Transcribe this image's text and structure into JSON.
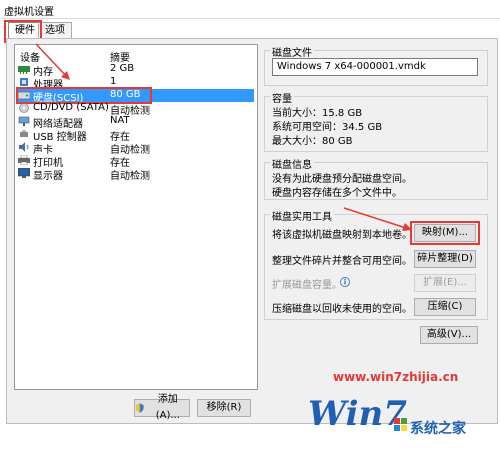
{
  "window": {
    "title": "虚拟机设置"
  },
  "tabs": [
    {
      "label": "硬件",
      "active": true
    },
    {
      "label": "选项",
      "active": false
    }
  ],
  "device_table": {
    "col_device": "设备",
    "col_summary": "摘要",
    "rows": [
      {
        "name": "内存",
        "summary": "2 GB",
        "icon": "memory-icon"
      },
      {
        "name": "处理器",
        "summary": "1",
        "icon": "processor-icon"
      },
      {
        "name": "硬盘(SCSI)",
        "summary": "80 GB",
        "icon": "hard-disk-icon",
        "selected": true
      },
      {
        "name": "CD/DVD (SATA)",
        "summary": "自动检测",
        "icon": "cd-dvd-icon"
      },
      {
        "name": "网络适配器",
        "summary": "NAT",
        "icon": "network-adapter-icon"
      },
      {
        "name": "USB 控制器",
        "summary": "存在",
        "icon": "usb-icon"
      },
      {
        "name": "声卡",
        "summary": "自动检测",
        "icon": "sound-card-icon"
      },
      {
        "name": "打印机",
        "summary": "存在",
        "icon": "printer-icon"
      },
      {
        "name": "显示器",
        "summary": "自动检测",
        "icon": "display-icon"
      }
    ]
  },
  "buttons": {
    "add": "添加(A)...",
    "remove": "移除(R)"
  },
  "disk_file": {
    "label": "磁盘文件",
    "value": "Windows 7 x64-000001.vmdk"
  },
  "capacity": {
    "label": "容量",
    "current": "当前大小：15.8 GB",
    "free": "系统可用空间：34.5 GB",
    "max": "最大大小：80 GB"
  },
  "disk_info": {
    "label": "磁盘信息",
    "line1": "没有为此硬盘预分配磁盘空间。",
    "line2": "硬盘内容存储在多个文件中。"
  },
  "utilities": {
    "label": "磁盘实用工具",
    "map_desc": "将该虚拟机磁盘映射到本地卷。",
    "map_btn": "映射(M)...",
    "defrag_desc": "整理文件碎片并整合可用空间。",
    "defrag_btn": "碎片整理(D)",
    "expand_desc": "扩展磁盘容量。",
    "expand_btn": "扩展(E)...",
    "compact_desc": "压缩磁盘以回收未使用的空间。",
    "compact_btn": "压缩(C)"
  },
  "advanced_btn": "高级(V)...",
  "watermark": {
    "url": "www.win7zhijia.cn",
    "logo_text": "Win7",
    "logo_cn": "系统之家"
  },
  "colors": {
    "highlight": "#e53935",
    "selection": "#3399ff",
    "accent": "#1f5fb4"
  }
}
